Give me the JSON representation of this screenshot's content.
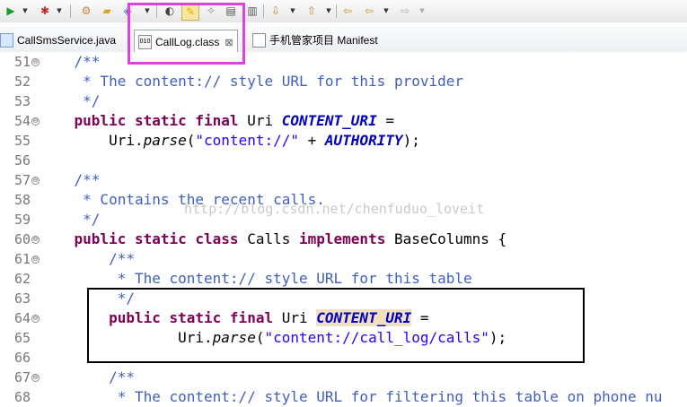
{
  "toolbar": {
    "icons": [
      "run-icon",
      "debug-icon",
      "new-server-icon",
      "open-folder-icon",
      "open-type-icon",
      "external-tools-icon",
      "toggle-breakpoint-icon",
      "mark-occurrences-icon",
      "annotation-icon",
      "show-whitespace-icon",
      "block-selection-icon",
      "next-annotation-icon",
      "prev-annotation-icon",
      "last-edit-icon",
      "back-icon",
      "forward-icon"
    ]
  },
  "tabs": [
    {
      "label": "CallSmsService.java"
    },
    {
      "label": "CallLog.class",
      "active": true,
      "close": "⊠"
    },
    {
      "label": "手机管家项目 Manifest"
    }
  ],
  "editor": {
    "lines": [
      {
        "num": "51",
        "fold": "⊖"
      },
      {
        "num": "52"
      },
      {
        "num": "53"
      },
      {
        "num": "54",
        "fold": "⊖"
      },
      {
        "num": "55"
      },
      {
        "num": "56"
      },
      {
        "num": "57",
        "fold": "⊖"
      },
      {
        "num": "58"
      },
      {
        "num": "59"
      },
      {
        "num": "60",
        "fold": "⊖"
      },
      {
        "num": "61",
        "fold": "⊖"
      },
      {
        "num": "62"
      },
      {
        "num": "63"
      },
      {
        "num": "64",
        "fold": "⊖"
      },
      {
        "num": "65"
      },
      {
        "num": "66"
      },
      {
        "num": "67",
        "fold": "⊖"
      },
      {
        "num": "68"
      }
    ],
    "code": {
      "l51": "    /**",
      "l52": "     * The content:// style URL for this provider",
      "l53": "     */",
      "l54_kw": "public static final",
      "l54_type": " Uri ",
      "l54_field": "CONTENT_URI",
      "l54_end": " =",
      "l55_pre": "        Uri.",
      "l55_method": "parse",
      "l55_open": "(",
      "l55_str": "\"content://\"",
      "l55_plus": " + ",
      "l55_field": "AUTHORITY",
      "l55_end": ");",
      "l57": "    /**",
      "l58": "     * Contains the recent calls.",
      "l59": "     */",
      "l60_kw1": "public static class",
      "l60_name": " Calls ",
      "l60_kw2": "implements",
      "l60_end": " BaseColumns {",
      "l61": "        /**",
      "l62": "         * The content:// style URL for this table",
      "l63": "         */",
      "l64_kw": "public static final",
      "l64_type": " Uri ",
      "l64_field": "CONTENT_URI",
      "l64_end": " =",
      "l65_pre": "                Uri.",
      "l65_method": "parse",
      "l65_open": "(",
      "l65_str": "\"content://call_log/calls\"",
      "l65_end": ");",
      "l67": "        /**",
      "l68": "         * The content:// style URL for filtering this table on phone nu"
    },
    "watermark": "http://blog.csdn.net/chenfuduo_loveit"
  },
  "colors": {
    "keyword": "#7f0055",
    "comment": "#3f5fbf",
    "string": "#2a00ff",
    "field": "#0000c0",
    "highlight_border": "#e040e0"
  }
}
